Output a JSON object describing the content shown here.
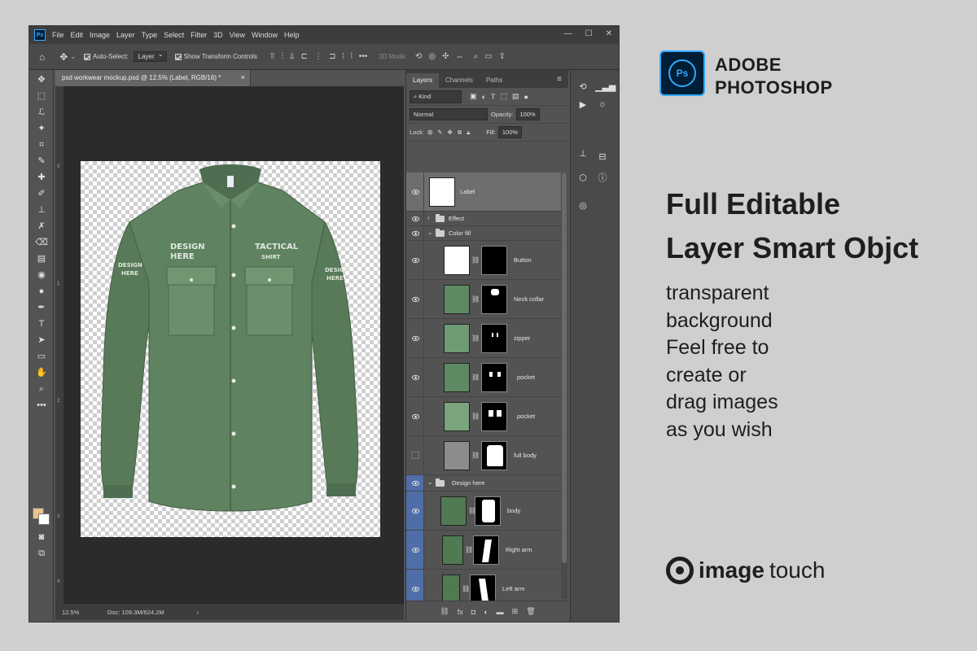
{
  "app": {
    "icon_label": "Ps",
    "menu": [
      "File",
      "Edit",
      "Image",
      "Layer",
      "Type",
      "Select",
      "Filter",
      "3D",
      "View",
      "Window",
      "Help"
    ],
    "window_controls": [
      "—",
      "☐",
      "✕"
    ]
  },
  "options_bar": {
    "auto_select_label": "Auto-Select:",
    "auto_select_value": "Layer",
    "transform_label": "Show Transform Controls",
    "mode_3d_label": "3D Mode:"
  },
  "document": {
    "tab_title": "psd workwear mockup.psd @ 12.5% (Label, RGB/16) *",
    "close_label": "×",
    "ruler_marks": [
      "0",
      "1",
      "2",
      "3",
      "4"
    ],
    "shirt_texts": {
      "chest_left": [
        "DESIGN",
        "HERE"
      ],
      "chest_right": [
        "TACTICAL",
        "SHIRT"
      ],
      "sleeve_left": [
        "DESIGN",
        "HERE"
      ],
      "sleeve_right": [
        "DESIGN",
        "HERE"
      ]
    },
    "shirt_color": "#5a7a5c"
  },
  "status_bar": {
    "zoom": "12.5%",
    "doc_info": "Doc: 109.3M/624.2M",
    "arrow": "›"
  },
  "layers_panel": {
    "tabs": [
      "Layers",
      "Channels",
      "Paths"
    ],
    "filter_kind": "Kind",
    "blend_mode": "Normal",
    "opacity_label": "Opacity:",
    "opacity_value": "100%",
    "lock_label": "Lock:",
    "fill_label": "Fill:",
    "fill_value": "100%",
    "layers": [
      {
        "name": "Label",
        "visible": true,
        "selected": true
      },
      {
        "name": "Effect",
        "visible": true,
        "group": true,
        "expanded": false
      },
      {
        "name": "Color fill",
        "visible": true,
        "group": true,
        "expanded": true
      },
      {
        "name": "Button",
        "visible": true
      },
      {
        "name": "Neck collar",
        "visible": true
      },
      {
        "name": "zipper",
        "visible": true
      },
      {
        "name": "pocket",
        "visible": true
      },
      {
        "name": "pocket",
        "visible": true
      },
      {
        "name": "full body",
        "visible": false
      },
      {
        "name": "Design here",
        "visible": true,
        "group": true,
        "expanded": true
      },
      {
        "name": "body",
        "visible": true
      },
      {
        "name": "Right arm",
        "visible": true
      },
      {
        "name": "Left arm",
        "visible": true
      }
    ]
  },
  "promo": {
    "logo_label": "Ps",
    "brand_line1": "ADOBE",
    "brand_line2": "PHOTOSHOP",
    "headline_line1": "Full Editable",
    "headline_line2": "Layer Smart Objct",
    "body_lines": [
      "transparent",
      "background",
      "Feel free to",
      "create or",
      "drag images",
      "as you wish"
    ],
    "brand_bold": "image",
    "brand_regular": "touch"
  }
}
